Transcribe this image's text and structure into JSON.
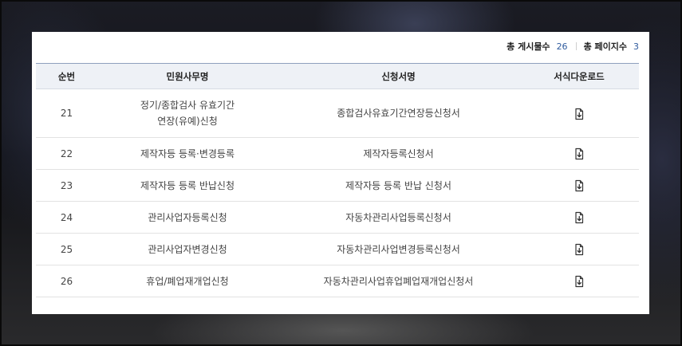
{
  "summary": {
    "total_posts_label": "총 게시물수",
    "total_posts": "26",
    "total_pages_label": "총 페이지수",
    "total_pages": "3"
  },
  "table": {
    "headers": {
      "no": "순번",
      "service": "민원사무명",
      "form": "신청서명",
      "download": "서식다운로드"
    },
    "rows": [
      {
        "no": "21",
        "service": "정기/종합검사 유효기간\n연장(유예)신청",
        "form": "종합검사유효기간연장등신청서",
        "download_icon": "file-download-icon"
      },
      {
        "no": "22",
        "service": "제작자등 등록·변경등록",
        "form": "제작자등록신청서",
        "download_icon": "file-download-icon"
      },
      {
        "no": "23",
        "service": "제작자등 등록 반납신청",
        "form": "제작자등 등록 반납 신청서",
        "download_icon": "file-download-icon"
      },
      {
        "no": "24",
        "service": "관리사업자등록신청",
        "form": "자동차관리사업등록신청서",
        "download_icon": "file-download-icon"
      },
      {
        "no": "25",
        "service": "관리사업자변경신청",
        "form": "자동차관리사업변경등록신청서",
        "download_icon": "file-download-icon"
      },
      {
        "no": "26",
        "service": "휴업/폐업재개업신청",
        "form": "자동차관리사업휴업폐업재개업신청서",
        "download_icon": "file-download-icon"
      }
    ]
  },
  "colors": {
    "accent_number": "#2f5b9e",
    "header_bg": "#eef1f6",
    "header_top_border": "#8ea0bd"
  }
}
